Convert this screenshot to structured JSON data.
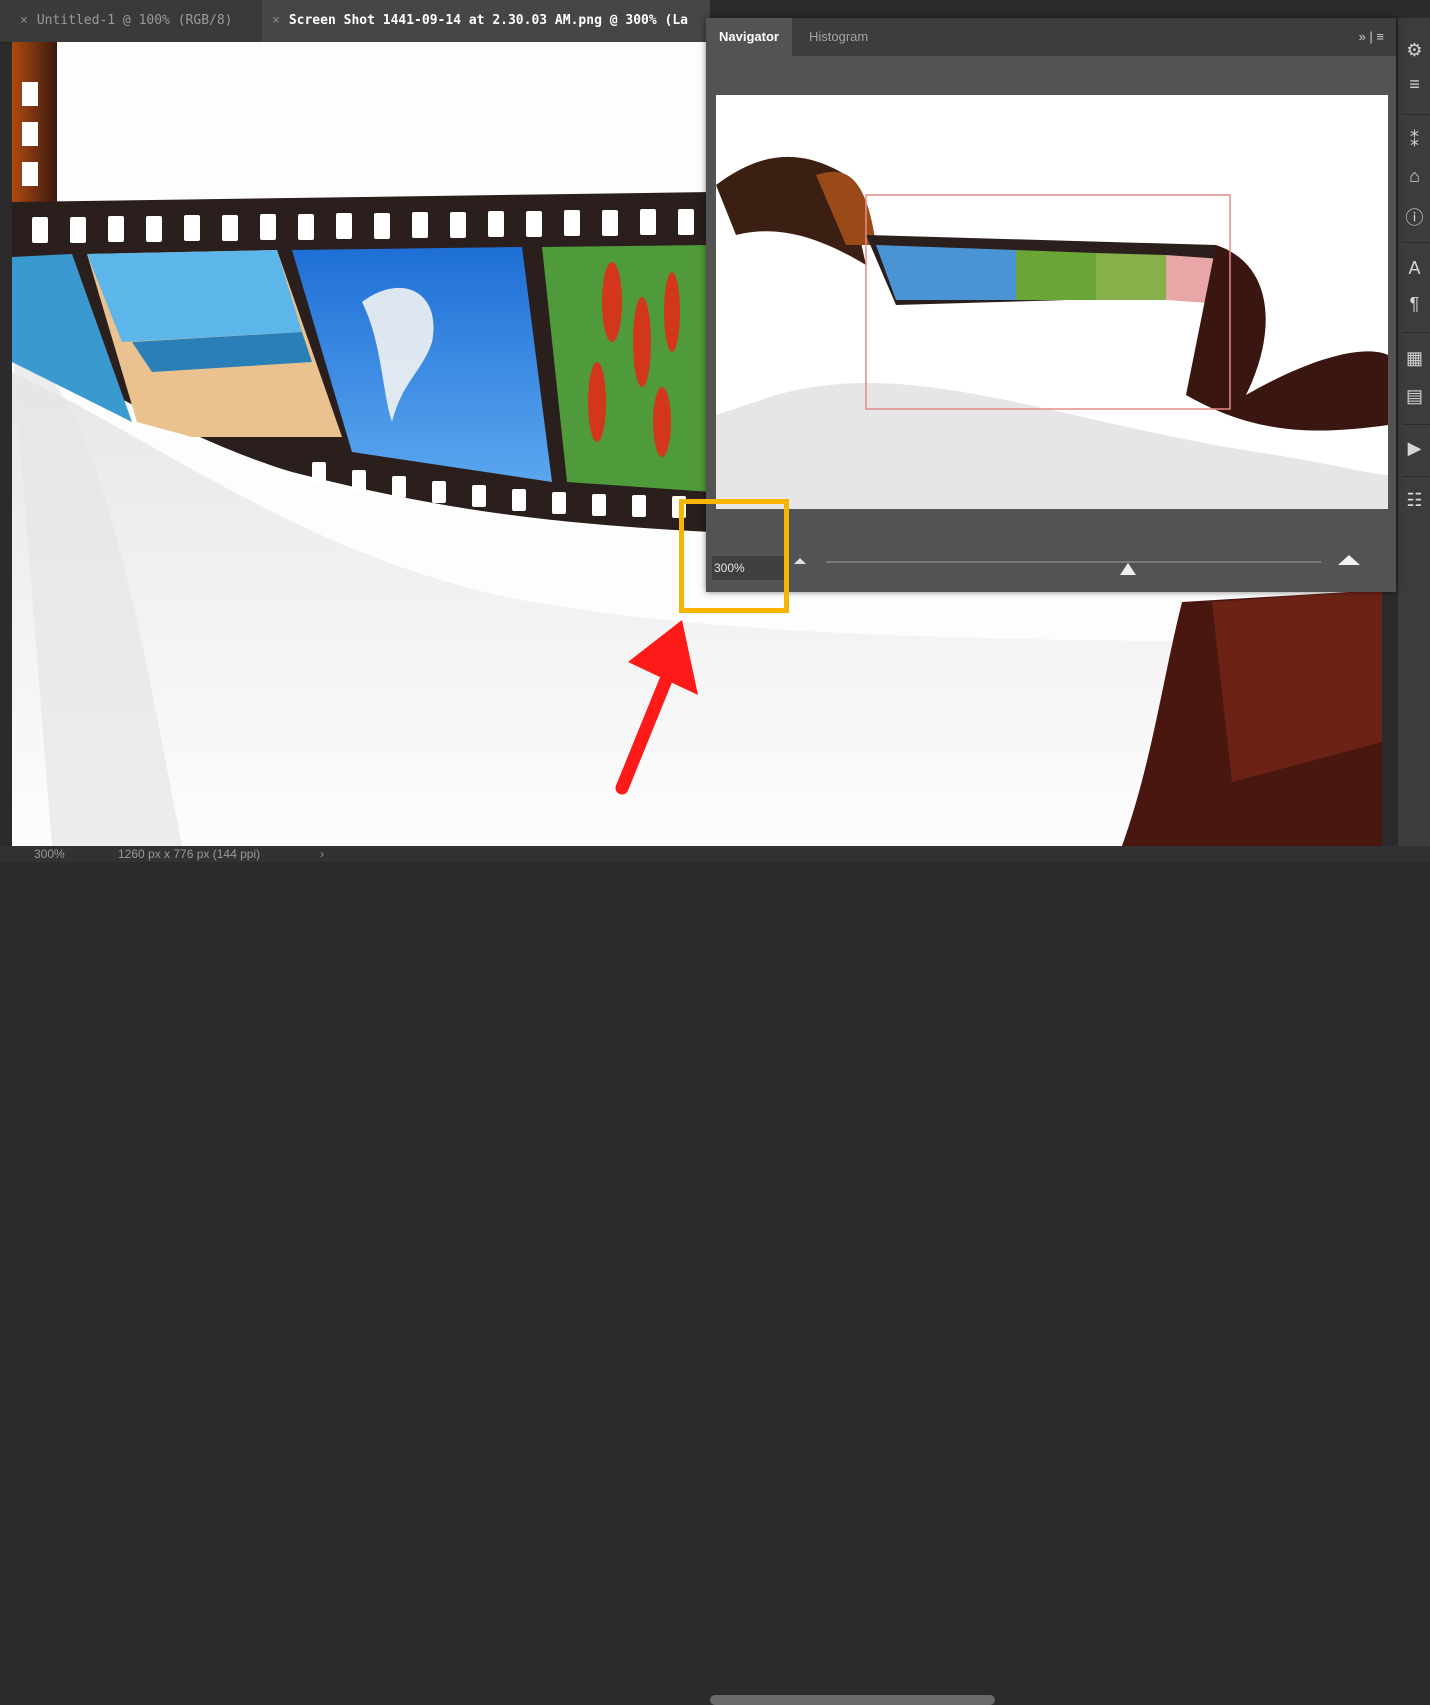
{
  "document_tabs": [
    {
      "close": "×",
      "label": "Untitled-1 @ 100% (RGB/8)"
    },
    {
      "close": "×",
      "label": "Screen Shot 1441-09-14 at 2.30.03 AM.png @ 300% (La"
    }
  ],
  "navigator_panel": {
    "tabs": [
      "Navigator",
      "Histogram"
    ],
    "active_tab": "Navigator",
    "menu_glyph": "» | ≡",
    "zoom_value": "300%",
    "zoom_slider_level": 0.61
  },
  "status_bar": {
    "zoom": "300%",
    "doc_info": "1260 px x 776 px (144 ppi)",
    "arrow": "›"
  },
  "right_toolbar_icons": [
    "navigator-icon",
    "histogram-icon",
    "properties-icon",
    "libraries-icon",
    "info-icon",
    "character-icon",
    "paragraph-icon",
    "layers-icon",
    "notes-icon",
    "play-icon",
    "actions-icon"
  ],
  "right_toolbar_glyphs": [
    "⚙",
    "≡",
    "⁑",
    "⌂",
    "ⓘ",
    "A",
    "¶",
    "▦",
    "▤",
    "▶",
    "☷"
  ],
  "annotation_colors": {
    "highlight": "#f8b500",
    "arrow": "#ff1a1a",
    "view_rect": "#e88a8a"
  }
}
